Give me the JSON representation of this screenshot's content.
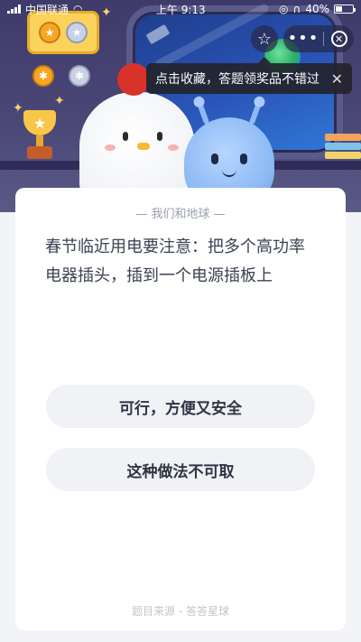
{
  "status_bar": {
    "carrier": "中国联通",
    "time": "上午 9:13",
    "battery_percent": "40%",
    "battery_level": 0.4
  },
  "top_bar": {
    "tooltip_text": "点击收藏，答题领奖品不错过",
    "more_label": "•••",
    "star_icon": "star-outline-icon",
    "close_icon": "close-circle-icon"
  },
  "question_card": {
    "category": "— 我们和地球 —",
    "question": "春节临近用电要注意：把多个高功率电器插头，插到一个电源插板上",
    "options": [
      {
        "label": "可行，方便又安全"
      },
      {
        "label": "这种做法不可取"
      }
    ],
    "source": "题目来源 - 答答星球"
  },
  "colors": {
    "scene_bg": "#45416f",
    "card_bg": "#ffffff",
    "option_bg": "#f0f2f6",
    "question_text": "#3b4252",
    "chicken_comb": "#d8322b",
    "alien_body": "#8db9f4"
  }
}
